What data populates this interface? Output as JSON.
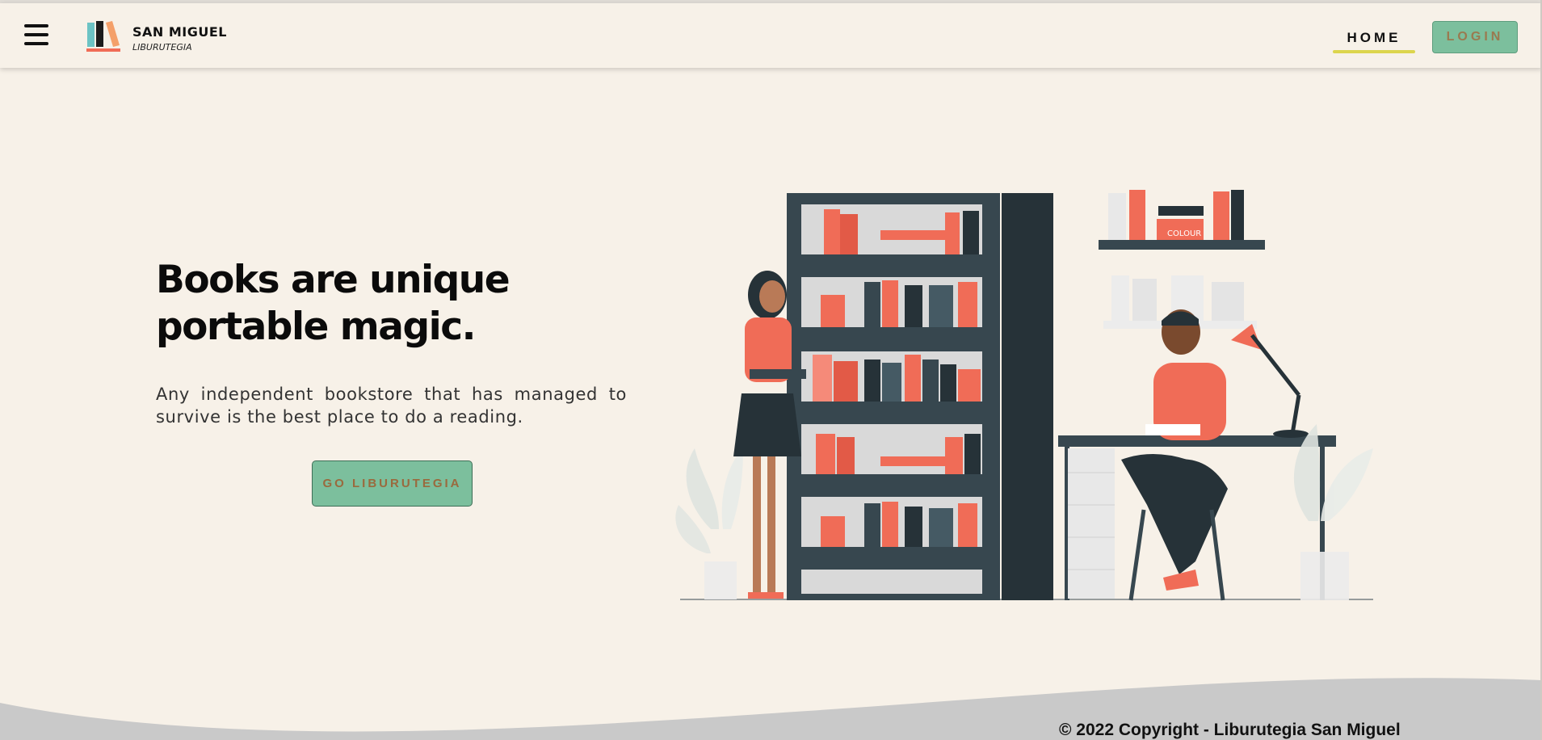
{
  "header": {
    "brand_name": "SAN MIGUEL",
    "brand_subtitle": "LIBURUTEGIA",
    "menu_icon": "hamburger-menu-icon",
    "logo_icon": "books-logo-icon",
    "nav": {
      "home_label": "HOME",
      "login_label": "LOGIN"
    }
  },
  "hero": {
    "title": "Books are unique portable magic.",
    "description": "Any independent bookstore that has managed to survive is the best place to do a reading.",
    "cta_label": "GO LIBURUTEGIA",
    "illustration_book_label": "COLOUR"
  },
  "footer": {
    "copyright": "© 2022 Copyright - Liburutegia San Miguel"
  },
  "colors": {
    "background": "#f7f1e8",
    "accent_green": "#7cbf9d",
    "accent_coral": "#f06c57",
    "home_underline": "#dcd54d",
    "dark": "#37474f",
    "footer_wave": "#c9c9c9"
  }
}
